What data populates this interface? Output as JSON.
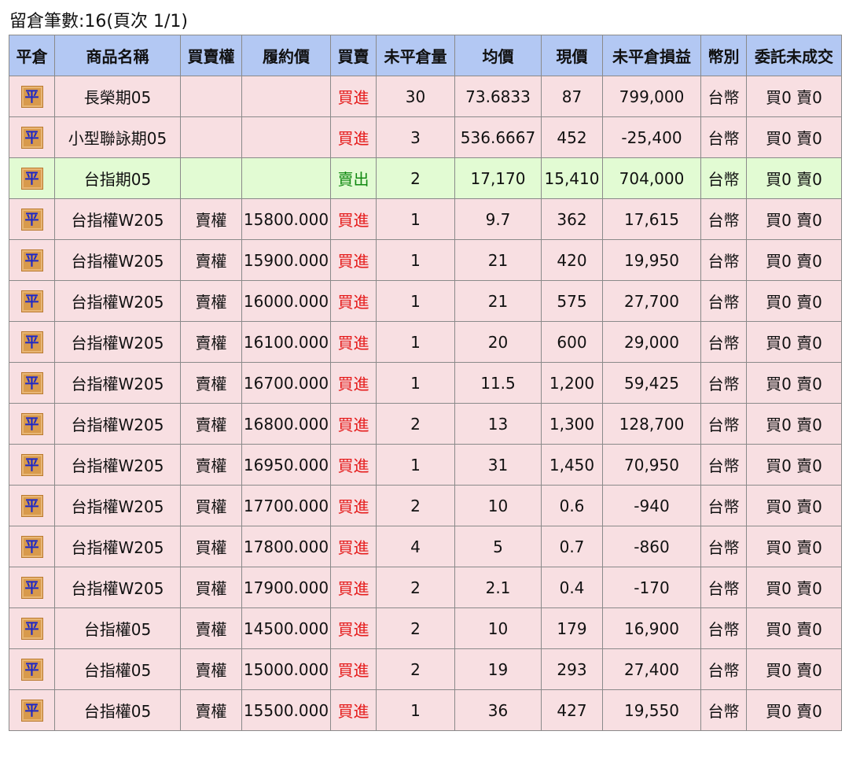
{
  "summary": {
    "text": "留倉筆數:16(頁次 1/1)"
  },
  "table": {
    "headers": [
      "平倉",
      "商品名稱",
      "買賣權",
      "履約價",
      "買賣",
      "未平倉量",
      "均價",
      "現價",
      "未平倉損益",
      "幣別",
      "委託未成交"
    ],
    "close_label": "平",
    "rows": [
      {
        "name": "長榮期05",
        "cp": "",
        "strike": "",
        "side": "買進",
        "qty": "30",
        "avg": "73.6833",
        "price": "87",
        "pnl": "799,000",
        "cur": "台幣",
        "pending": "買0 賣0"
      },
      {
        "name": "小型聯詠期05",
        "cp": "",
        "strike": "",
        "side": "買進",
        "qty": "3",
        "avg": "536.6667",
        "price": "452",
        "pnl": "-25,400",
        "cur": "台幣",
        "pending": "買0 賣0"
      },
      {
        "name": "台指期05",
        "cp": "",
        "strike": "",
        "side": "賣出",
        "qty": "2",
        "avg": "17,170",
        "price": "15,410",
        "pnl": "704,000",
        "cur": "台幣",
        "pending": "買0 賣0"
      },
      {
        "name": "台指權W205",
        "cp": "賣權",
        "strike": "15800.000",
        "side": "買進",
        "qty": "1",
        "avg": "9.7",
        "price": "362",
        "pnl": "17,615",
        "cur": "台幣",
        "pending": "買0 賣0"
      },
      {
        "name": "台指權W205",
        "cp": "賣權",
        "strike": "15900.000",
        "side": "買進",
        "qty": "1",
        "avg": "21",
        "price": "420",
        "pnl": "19,950",
        "cur": "台幣",
        "pending": "買0 賣0"
      },
      {
        "name": "台指權W205",
        "cp": "賣權",
        "strike": "16000.000",
        "side": "買進",
        "qty": "1",
        "avg": "21",
        "price": "575",
        "pnl": "27,700",
        "cur": "台幣",
        "pending": "買0 賣0"
      },
      {
        "name": "台指權W205",
        "cp": "賣權",
        "strike": "16100.000",
        "side": "買進",
        "qty": "1",
        "avg": "20",
        "price": "600",
        "pnl": "29,000",
        "cur": "台幣",
        "pending": "買0 賣0"
      },
      {
        "name": "台指權W205",
        "cp": "賣權",
        "strike": "16700.000",
        "side": "買進",
        "qty": "1",
        "avg": "11.5",
        "price": "1,200",
        "pnl": "59,425",
        "cur": "台幣",
        "pending": "買0 賣0"
      },
      {
        "name": "台指權W205",
        "cp": "賣權",
        "strike": "16800.000",
        "side": "買進",
        "qty": "2",
        "avg": "13",
        "price": "1,300",
        "pnl": "128,700",
        "cur": "台幣",
        "pending": "買0 賣0"
      },
      {
        "name": "台指權W205",
        "cp": "賣權",
        "strike": "16950.000",
        "side": "買進",
        "qty": "1",
        "avg": "31",
        "price": "1,450",
        "pnl": "70,950",
        "cur": "台幣",
        "pending": "買0 賣0"
      },
      {
        "name": "台指權W205",
        "cp": "買權",
        "strike": "17700.000",
        "side": "買進",
        "qty": "2",
        "avg": "10",
        "price": "0.6",
        "pnl": "-940",
        "cur": "台幣",
        "pending": "買0 賣0"
      },
      {
        "name": "台指權W205",
        "cp": "買權",
        "strike": "17800.000",
        "side": "買進",
        "qty": "4",
        "avg": "5",
        "price": "0.7",
        "pnl": "-860",
        "cur": "台幣",
        "pending": "買0 賣0"
      },
      {
        "name": "台指權W205",
        "cp": "買權",
        "strike": "17900.000",
        "side": "買進",
        "qty": "2",
        "avg": "2.1",
        "price": "0.4",
        "pnl": "-170",
        "cur": "台幣",
        "pending": "買0 賣0"
      },
      {
        "name": "台指權05",
        "cp": "賣權",
        "strike": "14500.000",
        "side": "買進",
        "qty": "2",
        "avg": "10",
        "price": "179",
        "pnl": "16,900",
        "cur": "台幣",
        "pending": "買0 賣0"
      },
      {
        "name": "台指權05",
        "cp": "賣權",
        "strike": "15000.000",
        "side": "買進",
        "qty": "2",
        "avg": "19",
        "price": "293",
        "pnl": "27,400",
        "cur": "台幣",
        "pending": "買0 賣0"
      },
      {
        "name": "台指權05",
        "cp": "賣權",
        "strike": "15500.000",
        "side": "買進",
        "qty": "1",
        "avg": "36",
        "price": "427",
        "pnl": "19,550",
        "cur": "台幣",
        "pending": "買0 賣0"
      }
    ]
  },
  "colors": {
    "header_bg": "#b3c8f3",
    "buy_row_bg": "#f8dfe2",
    "sell_row_bg": "#e2fbd3",
    "buy_text": "#e51c1c",
    "sell_text": "#128a12",
    "close_button_bg": "#d89a4c",
    "close_button_text": "#1c28c8"
  }
}
